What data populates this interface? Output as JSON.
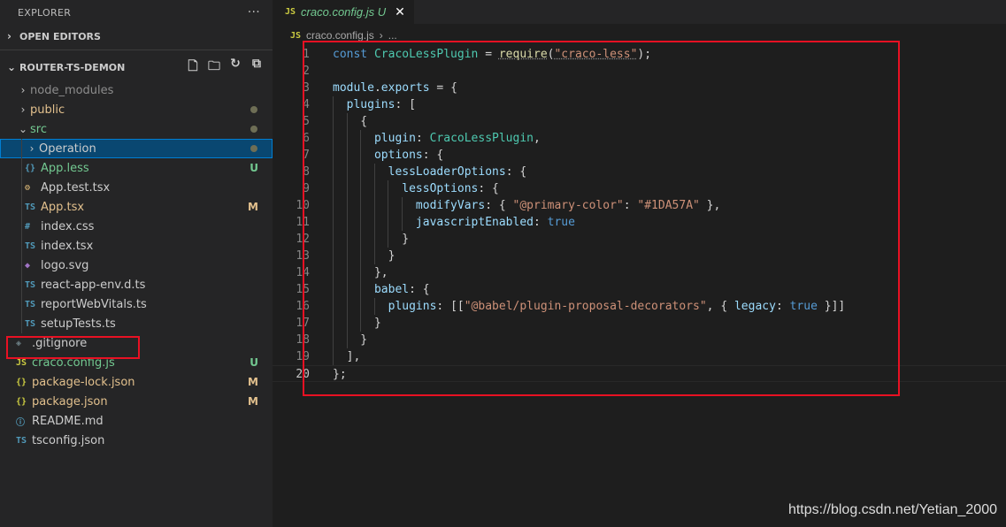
{
  "sidebar": {
    "header": "EXPLORER",
    "more": "···",
    "open_editors": "OPEN EDITORS",
    "project": "ROUTER-TS-DEMON",
    "tree": [
      {
        "label": "node_modules",
        "type": "folder",
        "expanded": false,
        "depth": 1,
        "color": "dim"
      },
      {
        "label": "public",
        "type": "folder",
        "expanded": false,
        "depth": 1,
        "color": "yellow",
        "dot": true
      },
      {
        "label": "src",
        "type": "folder",
        "expanded": true,
        "depth": 1,
        "color": "green",
        "dot": true
      },
      {
        "label": "Operation",
        "type": "folder",
        "expanded": false,
        "depth": 2,
        "color": "normal",
        "dot": true,
        "selected": true
      },
      {
        "label": "App.less",
        "icon": "{}",
        "iconClass": "c-less",
        "depth": 2,
        "color": "green",
        "badge": "U"
      },
      {
        "label": "App.test.tsx",
        "icon": "⚙",
        "iconClass": "c-test",
        "depth": 2,
        "color": "normal"
      },
      {
        "label": "App.tsx",
        "icon": "TS",
        "iconClass": "c-ts",
        "depth": 2,
        "color": "yellow",
        "badge": "M"
      },
      {
        "label": "index.css",
        "icon": "#",
        "iconClass": "c-css",
        "depth": 2,
        "color": "normal"
      },
      {
        "label": "index.tsx",
        "icon": "TS",
        "iconClass": "c-ts",
        "depth": 2,
        "color": "normal"
      },
      {
        "label": "logo.svg",
        "icon": "◆",
        "iconClass": "c-svg",
        "depth": 2,
        "color": "normal"
      },
      {
        "label": "react-app-env.d.ts",
        "icon": "TS",
        "iconClass": "c-ts",
        "depth": 2,
        "color": "normal"
      },
      {
        "label": "reportWebVitals.ts",
        "icon": "TS",
        "iconClass": "c-ts",
        "depth": 2,
        "color": "normal"
      },
      {
        "label": "setupTests.ts",
        "icon": "TS",
        "iconClass": "c-ts",
        "depth": 2,
        "color": "normal"
      },
      {
        "label": ".gitignore",
        "icon": "◈",
        "iconClass": "c-git",
        "depth": 1,
        "color": "normal"
      },
      {
        "label": "craco.config.js",
        "icon": "JS",
        "iconClass": "c-js",
        "depth": 1,
        "color": "green",
        "badge": "U"
      },
      {
        "label": "package-lock.json",
        "icon": "{}",
        "iconClass": "c-json",
        "depth": 1,
        "color": "yellow",
        "badge": "M"
      },
      {
        "label": "package.json",
        "icon": "{}",
        "iconClass": "c-json",
        "depth": 1,
        "color": "yellow",
        "badge": "M"
      },
      {
        "label": "README.md",
        "icon": "ⓘ",
        "iconClass": "c-info",
        "depth": 1,
        "color": "normal"
      },
      {
        "label": "tsconfig.json",
        "icon": "TS",
        "iconClass": "c-ts",
        "depth": 1,
        "color": "normal"
      }
    ]
  },
  "editor": {
    "tab": {
      "icon": "JS",
      "name": "craco.config.js",
      "status": "U"
    },
    "breadcrumb": {
      "icon": "JS",
      "file": "craco.config.js",
      "rest": "..."
    },
    "active_line": 20,
    "lines": [
      [
        [
          "k",
          "const "
        ],
        [
          "t",
          "CracoLessPlugin"
        ],
        [
          "p",
          " = "
        ],
        [
          "f",
          "require"
        ],
        [
          "p",
          "("
        ],
        [
          "s",
          "\"craco-less\""
        ],
        [
          "p",
          ");"
        ]
      ],
      [],
      [
        [
          "v",
          "module"
        ],
        [
          "p",
          "."
        ],
        [
          "v",
          "exports"
        ],
        [
          "p",
          " = {"
        ]
      ],
      [
        [
          "p",
          "  "
        ],
        [
          "v",
          "plugins"
        ],
        [
          "p",
          ": ["
        ]
      ],
      [
        [
          "p",
          "    {"
        ]
      ],
      [
        [
          "p",
          "      "
        ],
        [
          "v",
          "plugin"
        ],
        [
          "p",
          ": "
        ],
        [
          "t",
          "CracoLessPlugin"
        ],
        [
          "p",
          ","
        ]
      ],
      [
        [
          "p",
          "      "
        ],
        [
          "v",
          "options"
        ],
        [
          "p",
          ": {"
        ]
      ],
      [
        [
          "p",
          "        "
        ],
        [
          "v",
          "lessLoaderOptions"
        ],
        [
          "p",
          ": {"
        ]
      ],
      [
        [
          "p",
          "          "
        ],
        [
          "v",
          "lessOptions"
        ],
        [
          "p",
          ": {"
        ]
      ],
      [
        [
          "p",
          "            "
        ],
        [
          "v",
          "modifyVars"
        ],
        [
          "p",
          ": { "
        ],
        [
          "s",
          "\"@primary-color\""
        ],
        [
          "p",
          ": "
        ],
        [
          "s",
          "\"#1DA57A\""
        ],
        [
          "p",
          " },"
        ]
      ],
      [
        [
          "p",
          "            "
        ],
        [
          "v",
          "javascriptEnabled"
        ],
        [
          "p",
          ": "
        ],
        [
          "k",
          "true"
        ]
      ],
      [
        [
          "p",
          "          }"
        ]
      ],
      [
        [
          "p",
          "        }"
        ]
      ],
      [
        [
          "p",
          "      },"
        ]
      ],
      [
        [
          "p",
          "      "
        ],
        [
          "v",
          "babel"
        ],
        [
          "p",
          ": {"
        ]
      ],
      [
        [
          "p",
          "        "
        ],
        [
          "v",
          "plugins"
        ],
        [
          "p",
          ": [["
        ],
        [
          "s",
          "\"@babel/plugin-proposal-decorators\""
        ],
        [
          "p",
          ", { "
        ],
        [
          "v",
          "legacy"
        ],
        [
          "p",
          ": "
        ],
        [
          "k",
          "true"
        ],
        [
          "p",
          " }]]"
        ]
      ],
      [
        [
          "p",
          "      }"
        ]
      ],
      [
        [
          "p",
          "    }"
        ]
      ],
      [
        [
          "p",
          "  ],"
        ]
      ],
      [
        [
          "p",
          "};"
        ]
      ]
    ]
  },
  "watermark": "https://blog.csdn.net/Yetian_2000",
  "colors": {
    "highlight_box": "#e81123",
    "selection": "#094771",
    "untracked": "#73c991",
    "modified": "#e2c08d"
  }
}
